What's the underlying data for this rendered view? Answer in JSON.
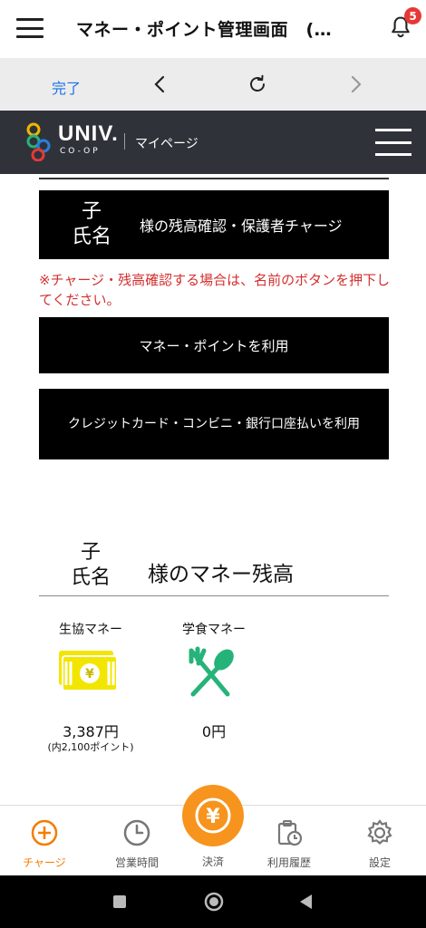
{
  "appbar": {
    "title": "マネー・ポイント管理画面　(…",
    "notification_count": "5"
  },
  "browser_nav": {
    "done_label": "完了"
  },
  "site_header": {
    "brand": "UNIV.",
    "brand_sub": "CO-OP",
    "section": "マイページ"
  },
  "content": {
    "child_name": "子\n氏名",
    "child_button_label": "様の残高確認・保護者チャージ",
    "warning": "※チャージ・残高確認する場合は、名前のボタンを押下してください。",
    "money_point_button": "マネー・ポイントを利用",
    "card_button": "クレジットカード・コンビニ・銀行口座払いを利用"
  },
  "balance": {
    "child_name": "子\n氏名",
    "title": "様のマネー残高",
    "coop_money": {
      "label": "生協マネー",
      "amount": "3,387円",
      "sub": "(内2,100ポイント)",
      "icon": "money-bill-icon",
      "icon_color": "#f2e600"
    },
    "cafeteria_money": {
      "label": "学食マネー",
      "amount": "0円",
      "icon": "fork-spoon-icon",
      "icon_color": "#26b37a"
    }
  },
  "tabbar": {
    "charge": "チャージ",
    "hours": "営業時間",
    "pay": "決済",
    "history": "利用履歴",
    "settings": "設定",
    "accent_color": "#f57c00"
  }
}
